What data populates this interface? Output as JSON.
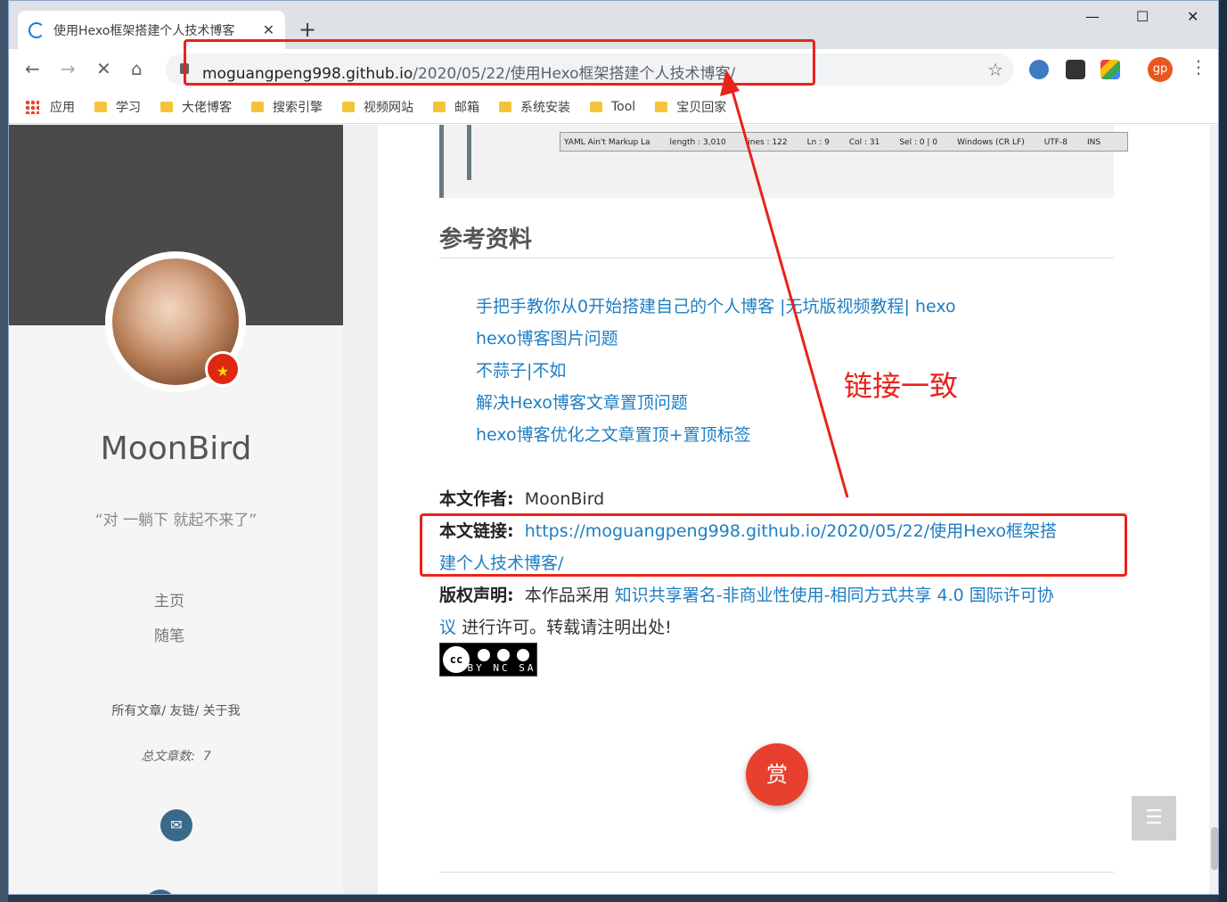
{
  "browser": {
    "tab_title": "使用Hexo框架搭建个人技术博客",
    "new_tab": "+",
    "minimize": "—",
    "maximize": "☐",
    "close": "✕",
    "url_host": "moguangpeng998.github.io",
    "url_path": "/2020/05/22/使用Hexo框架搭建个人技术博客/",
    "profile_initials": "gp"
  },
  "bookmarks": [
    {
      "label": "应用",
      "icon": "apps-grid-icon"
    },
    {
      "label": "学习",
      "icon": "folder-icon"
    },
    {
      "label": "大佬博客",
      "icon": "folder-icon"
    },
    {
      "label": "搜索引擎",
      "icon": "folder-icon"
    },
    {
      "label": "视频网站",
      "icon": "folder-icon"
    },
    {
      "label": "邮箱",
      "icon": "folder-icon"
    },
    {
      "label": "系统安装",
      "icon": "folder-icon"
    },
    {
      "label": "Tool",
      "icon": "folder-icon"
    },
    {
      "label": "宝贝回家",
      "icon": "folder-icon"
    }
  ],
  "sidebar": {
    "site_name": "MoonBird",
    "motto": "“对 一躺下 就起不来了”",
    "menu": [
      "主页",
      "随笔"
    ],
    "links": "所有文章/  友链/  关于我",
    "post_count_label": "总文章数:",
    "post_count": "7"
  },
  "content": {
    "statusbar": {
      "doc_type": "YAML Ain't Markup La",
      "length": "length : 3,010",
      "lines": "lines : 122",
      "ln": "Ln : 9",
      "col": "Col : 31",
      "sel": "Sel : 0 | 0",
      "eol": "Windows (CR LF)",
      "encoding": "UTF-8",
      "mode": "INS"
    },
    "section_title": "参考资料",
    "references": [
      "手把手教你从0开始搭建自己的个人博客 |无坑版视频教程| hexo",
      "hexo博客图片问题",
      "不蒜子|不如",
      "解决Hexo博客文章置顶问题",
      "hexo博客优化之文章置顶+置顶标签"
    ],
    "author_label": "本文作者:",
    "author": "MoonBird",
    "link_label": "本文链接:",
    "link_line1": "https://moguangpeng998.github.io/2020/05/22/使用Hexo框架搭",
    "link_line2": "建个人技术博客/",
    "copyright_label": "版权声明:",
    "copyright_prefix": "本作品采用",
    "license_line1": "知识共享署名-非商业性使用-相同方式共享 4.0 国际许可协",
    "license_line2": "议",
    "copyright_suffix": "进行许可。转载请注明出处!",
    "cc_badge_text": "BY NC SA",
    "cc_logo": "cc",
    "reward_label": "赏"
  },
  "annotation": {
    "text": "链接一致",
    "color": "#e8231a"
  }
}
